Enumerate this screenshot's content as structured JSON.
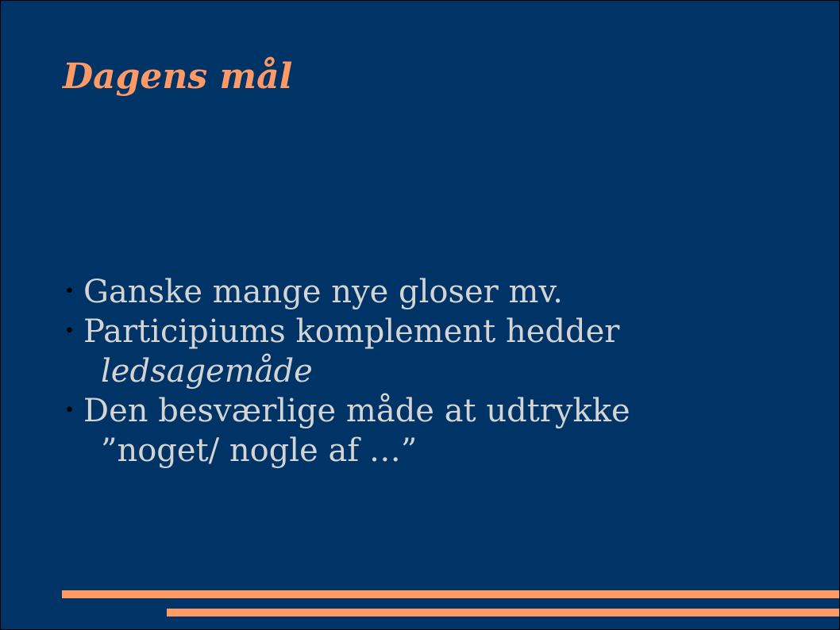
{
  "slide": {
    "title": "Dagens mål",
    "bullet_symbol": "•",
    "bullets": [
      {
        "text": "Ganske mange nye gloser mv.",
        "continuation": ""
      },
      {
        "text": "Participiums komplement hedder",
        "continuation": "ledsagemåde"
      },
      {
        "text": "Den besværlige måde at udtrykke",
        "continuation": "”noget/ nogle af …”"
      }
    ]
  },
  "colors": {
    "background": "#003366",
    "accent": "#ff9966",
    "body_text": "#d4d4d4",
    "bullet": "#000000"
  }
}
